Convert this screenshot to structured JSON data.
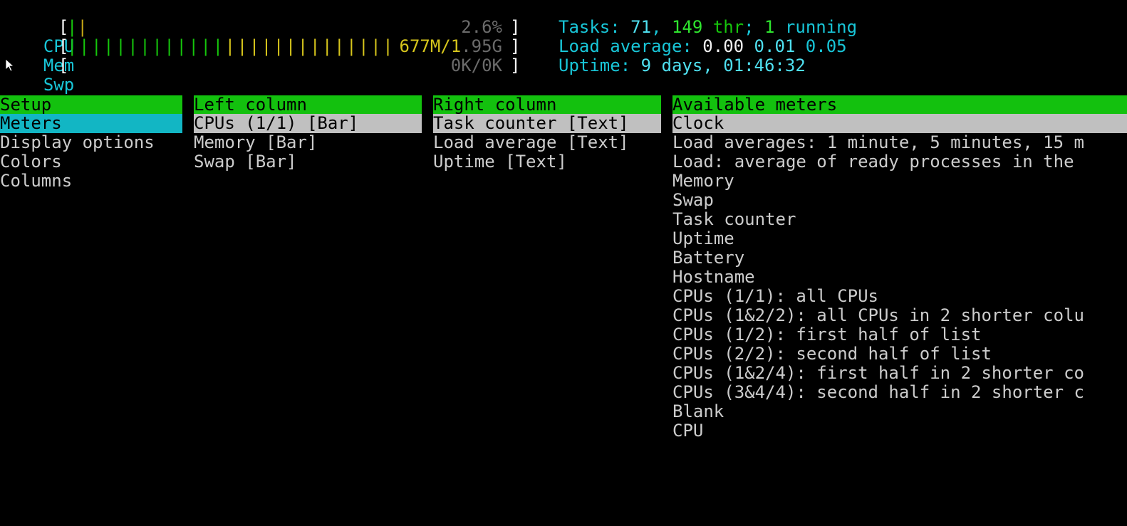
{
  "header": {
    "cpu": {
      "label": "CPU",
      "bar_green": "|",
      "bar_red": "|",
      "readout": "2.6%",
      "fraction": 0.026
    },
    "mem": {
      "label": "Mem",
      "bar_green": "|||||||||||||",
      "bar_yellow": "||||||||||||||",
      "readout_used": "677M/1",
      "readout_rest": ".95G",
      "fraction": 0.34
    },
    "swp": {
      "label": "Swp",
      "readout": "0K/0K",
      "fraction": 0
    },
    "tasks": {
      "label": "Tasks: ",
      "count": "71",
      "sep": ", ",
      "threads": "149",
      "thr_label": " thr",
      "sep2": "; ",
      "running": "1",
      "running_label": " running"
    },
    "load": {
      "label": "Load average: ",
      "one": "0.00",
      "five": "0.01",
      "fifteen": "0.05"
    },
    "uptime": {
      "label": "Uptime: ",
      "value": "9 days, 01:46:32"
    }
  },
  "setup": {
    "title": "Setup",
    "items": [
      "Meters",
      "Display options",
      "Colors",
      "Columns"
    ]
  },
  "left_column": {
    "title": "Left column",
    "items": [
      "CPUs (1/1) [Bar]",
      "Memory [Bar]",
      "Swap [Bar]"
    ]
  },
  "right_column": {
    "title": "Right column",
    "items": [
      "Task counter [Text]",
      "Load average [Text]",
      "Uptime [Text]"
    ]
  },
  "available_meters": {
    "title": "Available meters",
    "items": [
      "Clock",
      "Load averages: 1 minute, 5 minutes, 15 m",
      "Load: average of ready processes in the",
      "Memory",
      "Swap",
      "Task counter",
      "Uptime",
      "Battery",
      "Hostname",
      "CPUs (1/1): all CPUs",
      "CPUs (1&2/2): all CPUs in 2 shorter colu",
      "CPUs (1/2): first half of list",
      "CPUs (2/2): second half of list",
      "CPUs (1&2/4): first half in 2 shorter co",
      "CPUs (3&4/4): second half in 2 shorter c",
      "Blank",
      "CPU"
    ]
  },
  "colors": {
    "header_green": "#13c10e",
    "selected_cyan": "#12b6c4",
    "selected_grey": "#c0c0c0",
    "label_cyan": "#18c6d8"
  }
}
